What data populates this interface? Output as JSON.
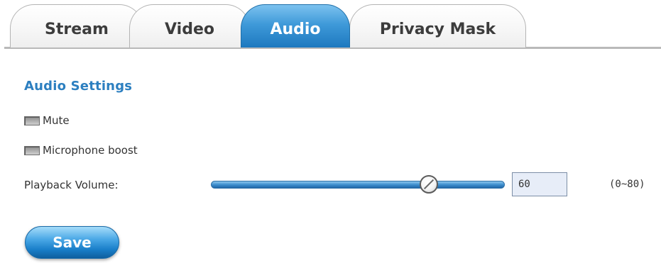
{
  "tabs": {
    "stream": "Stream",
    "video": "Video",
    "audio": "Audio",
    "privacy_mask": "Privacy Mask",
    "active": "Audio"
  },
  "audio_settings": {
    "title": "Audio Settings",
    "mute_label": "Mute",
    "mute_checked": false,
    "microphone_boost_label": "Microphone boost",
    "microphone_boost_checked": false,
    "playback_volume_label": "Playback Volume:",
    "playback_volume_value": "60",
    "playback_volume_range": "(0~80)",
    "volume_fraction": 0.75
  },
  "actions": {
    "save_label": "Save"
  },
  "colors": {
    "accent": "#2c7fc0",
    "active_tab": "#3f9ad9",
    "button": "#1a7fca"
  }
}
